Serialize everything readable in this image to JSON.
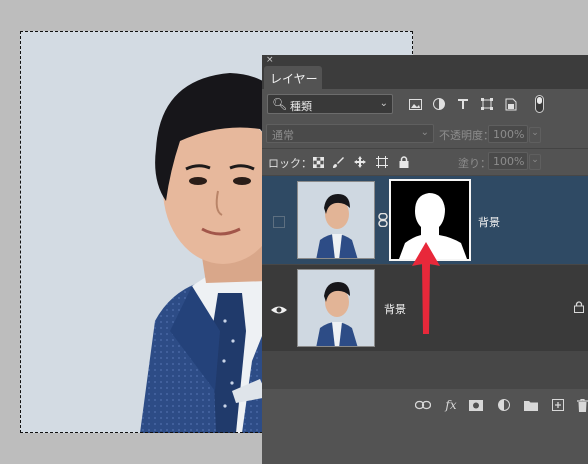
{
  "panel": {
    "close_glyph": "×",
    "tab_label": "レイヤー",
    "filter": {
      "icon": "search-icon",
      "value": "種類",
      "caret": "⌄"
    },
    "filter_icons": [
      "image-filter-icon",
      "adjustment-filter-icon",
      "type-filter-icon",
      "shape-filter-icon",
      "smart-object-filter-icon"
    ],
    "blend_mode": "通常",
    "opacity_label": "不透明度：",
    "opacity_value": "100%",
    "lock_label": "ロック：",
    "fill_label": "塗り：",
    "fill_value": "100%",
    "caret": "⌄"
  },
  "layers": [
    {
      "name": "背景",
      "selected": true,
      "visible": false,
      "has_mask": true,
      "locked": false
    },
    {
      "name": "背景",
      "selected": false,
      "visible": true,
      "has_mask": false,
      "locked": true
    }
  ],
  "bottom_icons": [
    "link-layers-icon",
    "fx-icon",
    "add-mask-icon",
    "adjustment-layer-icon",
    "new-group-icon",
    "new-layer-icon",
    "trash-icon"
  ],
  "fx_text": "fx",
  "colors": {
    "panel_bg": "#535353",
    "selected_layer": "#2f4a64",
    "arrow": "#e8283a",
    "canvas_bg": "#d3dbe3",
    "suit": "#2c4a84"
  }
}
